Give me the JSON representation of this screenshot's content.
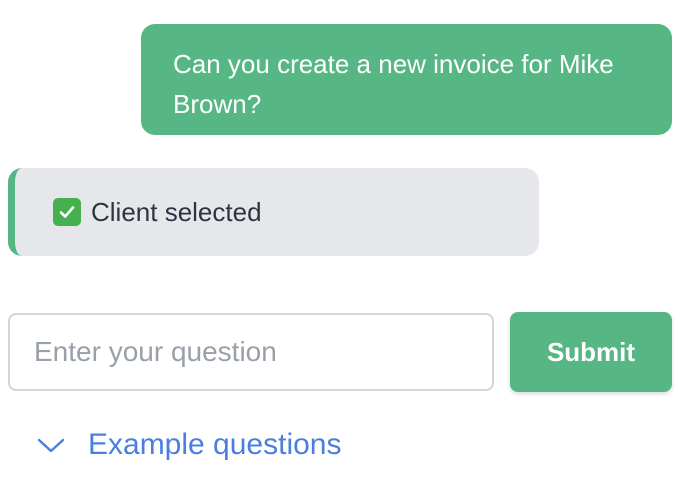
{
  "chat": {
    "user_message": "Can you create a new invoice for Mike Brown?",
    "status_message": "Client selected",
    "status_icon": "check-mark-icon"
  },
  "form": {
    "input_placeholder": "Enter your question",
    "input_value": "",
    "submit_label": "Submit"
  },
  "examples": {
    "toggle_label": "Example questions",
    "toggle_icon": "chevron-down-icon"
  },
  "colors": {
    "accent": "#56b785",
    "status_bg": "#e6e7ea",
    "link": "#4a7fe0",
    "check_icon_bg": "#45b04d"
  }
}
